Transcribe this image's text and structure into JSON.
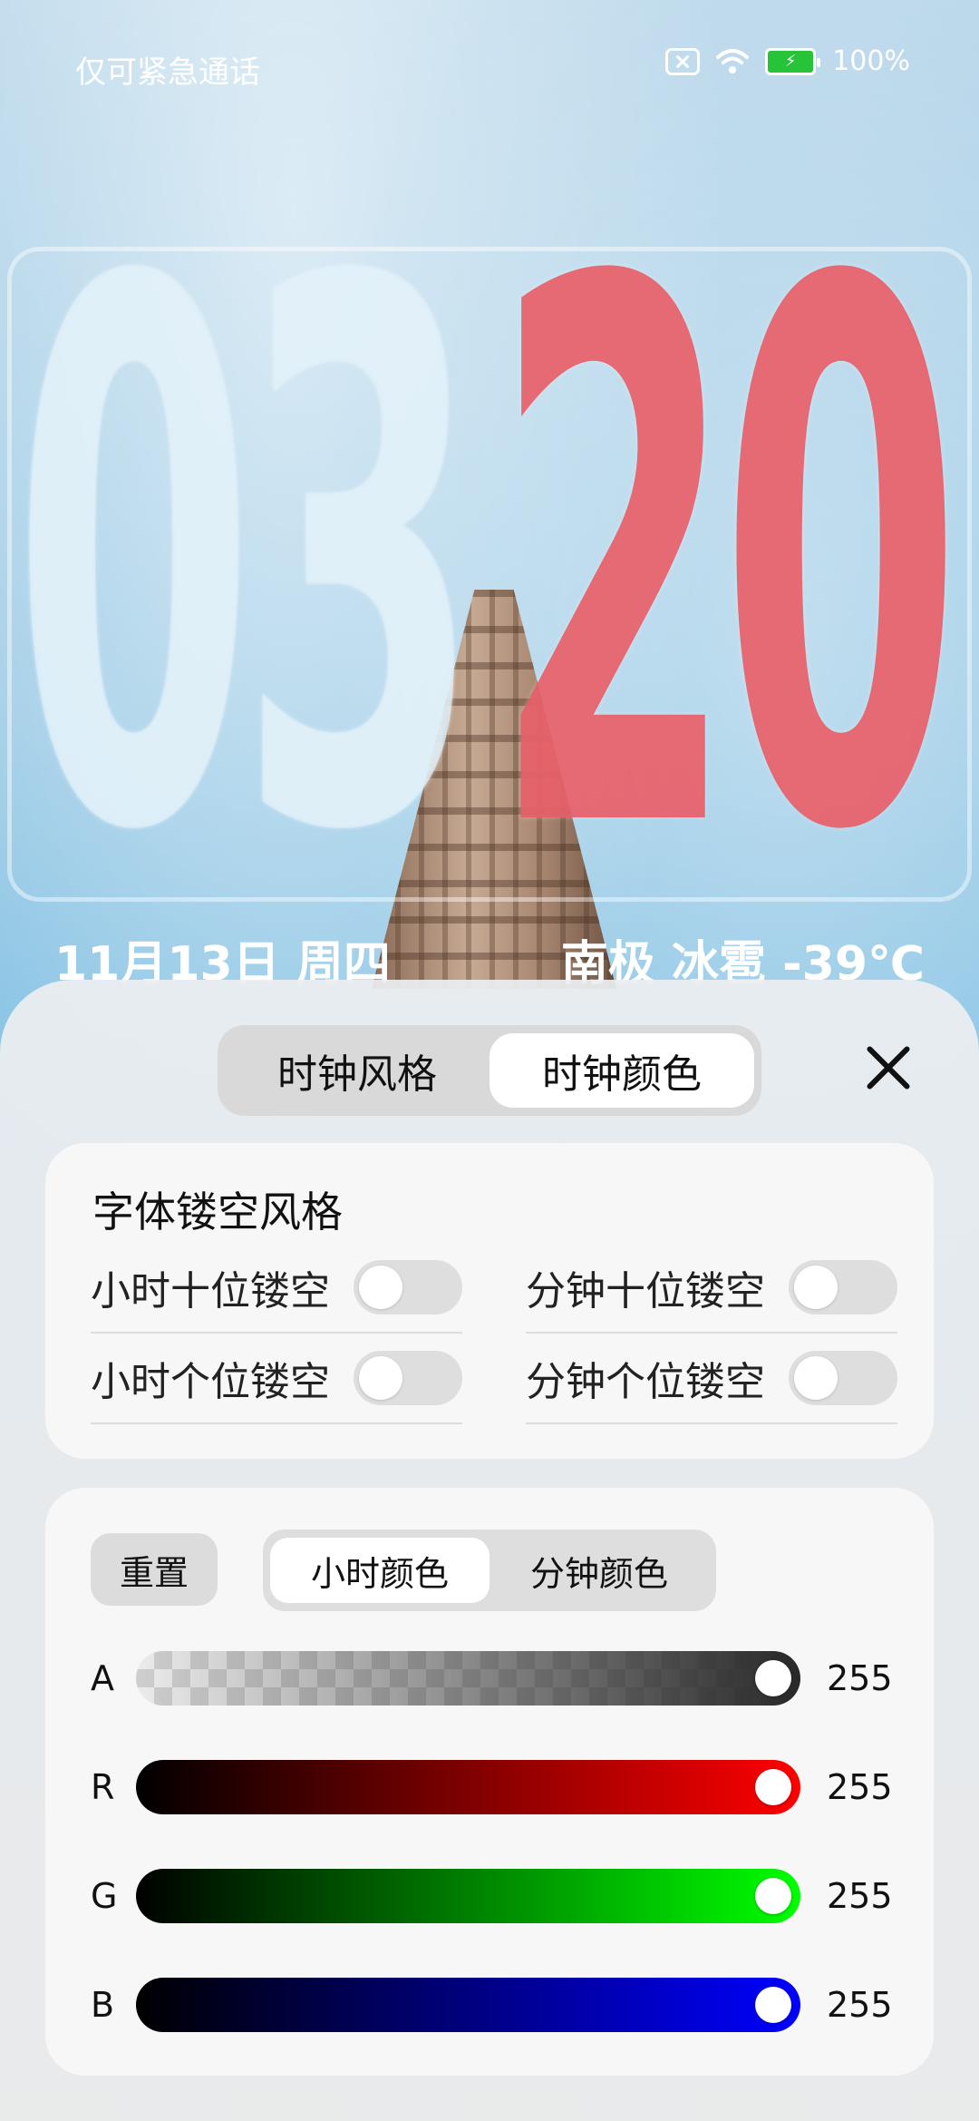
{
  "status": {
    "left_text": "仅可紧急通话",
    "battery": "100%",
    "icons": [
      "no-sim-icon",
      "wifi-icon",
      "battery-charging-icon"
    ]
  },
  "clock": {
    "hour_tens": "0",
    "hour_ones": "3",
    "minute_tens": "2",
    "minute_ones": "0",
    "date": "11月13日 周四",
    "weather": "南极 冰雹 -39℃",
    "colors": {
      "hour": "#dceef8",
      "minute": "#e85c66"
    }
  },
  "sheet": {
    "tabs": [
      {
        "label": "时钟风格",
        "active": false
      },
      {
        "label": "时钟颜色",
        "active": true
      }
    ],
    "hollow_card": {
      "title": "字体镂空风格",
      "toggles": [
        {
          "label": "小时十位镂空",
          "on": false
        },
        {
          "label": "分钟十位镂空",
          "on": false
        },
        {
          "label": "小时个位镂空",
          "on": false
        },
        {
          "label": "分钟个位镂空",
          "on": false
        }
      ]
    },
    "color_card": {
      "reset_label": "重置",
      "tabs": [
        {
          "label": "小时颜色",
          "active": true
        },
        {
          "label": "分钟颜色",
          "active": false
        }
      ],
      "sliders": [
        {
          "label": "A",
          "value": "255",
          "level": 1.0
        },
        {
          "label": "R",
          "value": "255",
          "level": 1.0
        },
        {
          "label": "G",
          "value": "255",
          "level": 1.0
        },
        {
          "label": "B",
          "value": "255",
          "level": 1.0
        }
      ]
    }
  }
}
